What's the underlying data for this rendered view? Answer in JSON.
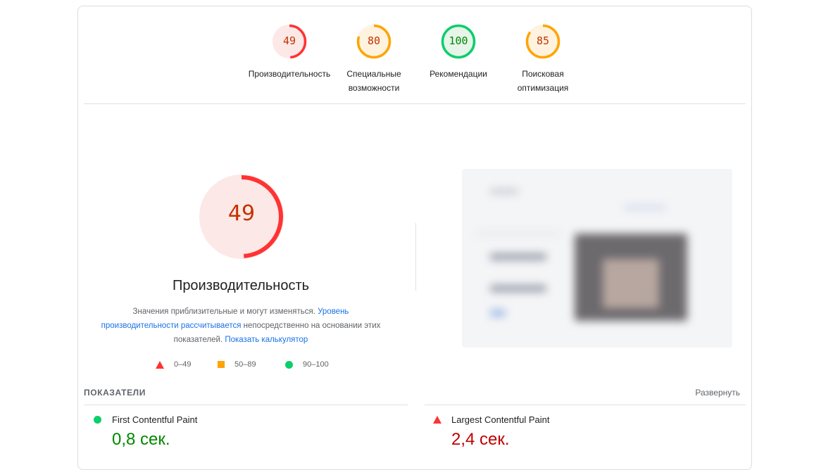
{
  "colors": {
    "fail": "#ff3333",
    "fail_text": "#c33300",
    "average": "#ffa400",
    "average_text": "#c33300",
    "pass": "#0cce6b",
    "pass_text": "#008800",
    "link": "#1a73e8"
  },
  "categories": [
    {
      "score": "49",
      "label": "Производительность",
      "value": 49,
      "rating": "fail"
    },
    {
      "score": "80",
      "label": "Специальные возможности",
      "value": 80,
      "rating": "average"
    },
    {
      "score": "100",
      "label": "Рекомендации",
      "value": 100,
      "rating": "pass"
    },
    {
      "score": "85",
      "label": "Поисковая оптимизация",
      "value": 85,
      "rating": "average"
    }
  ],
  "performance": {
    "score": "49",
    "value": 49,
    "title": "Производительность",
    "desc_prefix": "Значения приблизительные и могут изменяться. ",
    "desc_link1": "Уровень производительности рассчитывается",
    "desc_middle": " непосредственно на основании этих показателей. ",
    "desc_link2": "Показать калькулятор"
  },
  "legend": {
    "fail": "0–49",
    "average": "50–89",
    "pass": "90–100"
  },
  "metrics": {
    "heading": "ПОКАЗАТЕЛИ",
    "expand": "Развернуть",
    "items": [
      {
        "label": "First Contentful Paint",
        "value": "0,8 сек.",
        "rating": "pass"
      },
      {
        "label": "Largest Contentful Paint",
        "value": "2,4 сек.",
        "rating": "fail"
      }
    ]
  }
}
